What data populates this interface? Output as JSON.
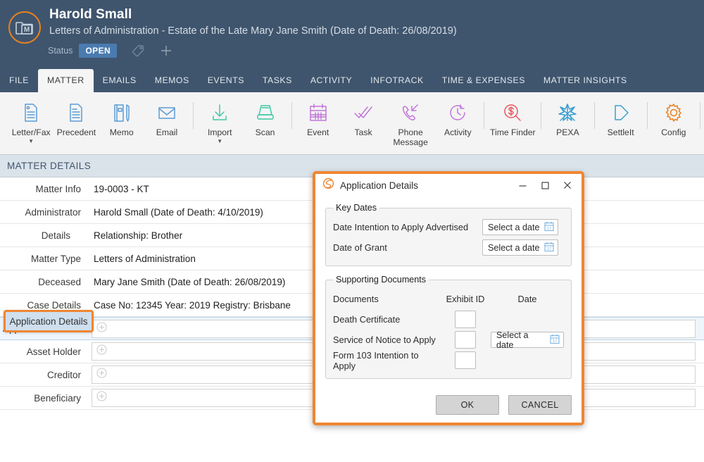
{
  "header": {
    "logo_icon": "matter-folder-m-icon",
    "matter_name": "Harold Small",
    "matter_description": "Letters of Administration - Estate of the Late Mary Jane Smith (Date of Death: 26/08/2019)",
    "status_label": "Status",
    "status_value": "OPEN",
    "tag_icon": "tag-icon",
    "add_icon": "plus-icon",
    "bg_color": "#3f556d",
    "accent_color": "#e8801f"
  },
  "tabs": [
    {
      "label": "FILE",
      "active": false
    },
    {
      "label": "MATTER",
      "active": true
    },
    {
      "label": "EMAILS",
      "active": false
    },
    {
      "label": "MEMOS",
      "active": false
    },
    {
      "label": "EVENTS",
      "active": false
    },
    {
      "label": "TASKS",
      "active": false
    },
    {
      "label": "ACTIVITY",
      "active": false
    },
    {
      "label": "INFOTRACK",
      "active": false
    },
    {
      "label": "TIME & EXPENSES",
      "active": false
    },
    {
      "label": "MATTER INSIGHTS",
      "active": false
    }
  ],
  "ribbon": [
    {
      "label": "Letter/Fax",
      "icon": "document-page-icon",
      "color": "#5b9bd5",
      "caret": true
    },
    {
      "label": "Precedent",
      "icon": "document-lines-icon",
      "color": "#5b9bd5",
      "caret": false
    },
    {
      "label": "Memo",
      "icon": "notebook-pen-icon",
      "color": "#5b9bd5",
      "caret": false
    },
    {
      "label": "Email",
      "icon": "envelope-icon",
      "color": "#5b9bd5",
      "caret": false
    },
    {
      "sep": true
    },
    {
      "label": "Import",
      "icon": "download-arrow-icon",
      "color": "#3fc8a4",
      "caret": true
    },
    {
      "label": "Scan",
      "icon": "scanner-icon",
      "color": "#3fc8a4",
      "caret": false
    },
    {
      "sep": true
    },
    {
      "label": "Event",
      "icon": "calendar-icon",
      "color": "#c175d8",
      "caret": false
    },
    {
      "label": "Task",
      "icon": "double-check-icon",
      "color": "#c175d8",
      "caret": false
    },
    {
      "label": "Phone Message",
      "icon": "phone-incoming-icon",
      "color": "#c175d8",
      "caret": false
    },
    {
      "label": "Activity",
      "icon": "clock-history-icon",
      "color": "#c175d8",
      "caret": false
    },
    {
      "sep": true
    },
    {
      "label": "Time Finder",
      "icon": "dollar-magnifier-icon",
      "color": "#e8555f",
      "caret": false
    },
    {
      "sep": true
    },
    {
      "label": "PEXA",
      "icon": "pexa-star-icon",
      "color": "#3a9fd0",
      "caret": false
    },
    {
      "sep": true
    },
    {
      "label": "SettleIt",
      "icon": "arrow-outline-icon",
      "color": "#3a9fd0",
      "caret": false
    },
    {
      "sep": true
    },
    {
      "label": "Config",
      "icon": "gear-icon",
      "color": "#e8801f",
      "caret": false
    },
    {
      "sep": true
    }
  ],
  "matter_details": {
    "section_title": "MATTER DETAILS",
    "rows": [
      {
        "key": "Matter Info",
        "value": "19-0003 - KT",
        "type": "text"
      },
      {
        "key": "Administrator",
        "value": "Harold Small (Date of Death: 4/10/2019)",
        "type": "text"
      },
      {
        "key": "Details",
        "value": "Relationship: Brother",
        "type": "text",
        "indent": true
      },
      {
        "key": "Matter Type",
        "value": "Letters of Administration",
        "type": "text"
      },
      {
        "key": "Deceased",
        "value": "Mary Jane Smith (Date of Death: 26/08/2019)",
        "type": "text"
      },
      {
        "key": "Case Details",
        "value": "Case No: 12345  Year: 2019  Registry: Brisbane",
        "type": "text"
      },
      {
        "key": "Application Details",
        "value": "",
        "type": "add",
        "selected": true,
        "add_icon": "circle-plus-icon"
      },
      {
        "key": "Asset Holder",
        "value": "",
        "type": "add",
        "add_icon": "circle-plus-icon"
      },
      {
        "key": "Creditor",
        "value": "",
        "type": "add",
        "add_icon": "circle-plus-icon"
      },
      {
        "key": "Beneficiary",
        "value": "",
        "type": "add",
        "add_icon": "circle-plus-icon"
      }
    ]
  },
  "dialog": {
    "icon": "smokeball-swirl-icon",
    "title": "Application Details",
    "minimize_icon": "minimize-icon",
    "maximize_icon": "maximize-icon",
    "close_icon": "close-icon",
    "highlight_color": "#ef8632",
    "key_dates": {
      "legend": "Key Dates",
      "fields": [
        {
          "label": "Date Intention to Apply Advertised",
          "value": "Select a date",
          "icon": "calendar-picker-icon"
        },
        {
          "label": "Date of Grant",
          "value": "Select a date",
          "icon": "calendar-picker-icon"
        }
      ]
    },
    "supporting_documents": {
      "legend": "Supporting Documents",
      "columns": [
        "Documents",
        "Exhibit ID",
        "Date"
      ],
      "rows": [
        {
          "document": "Death Certificate",
          "exhibit_id": "",
          "date": null
        },
        {
          "document": "Service of Notice to Apply",
          "exhibit_id": "",
          "date": "Select a date",
          "date_icon": "calendar-picker-icon"
        },
        {
          "document": "Form 103 Intention to Apply",
          "exhibit_id": "",
          "date": null
        }
      ]
    },
    "buttons": {
      "ok": "OK",
      "cancel": "CANCEL"
    }
  }
}
